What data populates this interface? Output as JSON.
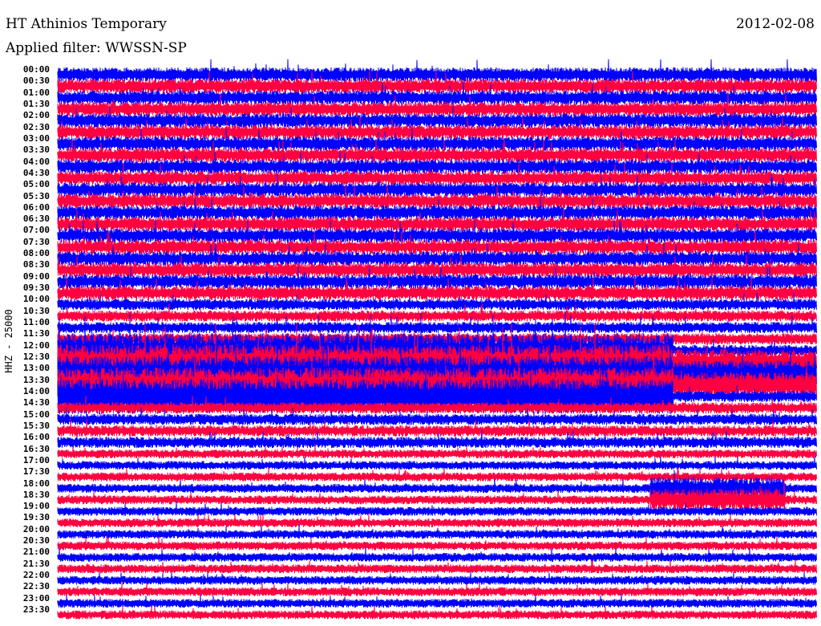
{
  "header": {
    "station": "HT Athinios Temporary",
    "filter": "Applied filter: WWSSN-SP",
    "date": "2012-02-08"
  },
  "chart_data": {
    "type": "line",
    "title": "HT Athinios Temporary",
    "ylabel": "HHZ - 25000",
    "row_labels": [
      "00:00",
      "00:30",
      "01:00",
      "01:30",
      "02:00",
      "02:30",
      "03:00",
      "03:30",
      "04:00",
      "04:30",
      "05:00",
      "05:30",
      "06:00",
      "06:30",
      "07:00",
      "07:30",
      "08:00",
      "08:30",
      "09:00",
      "09:30",
      "10:00",
      "10:30",
      "11:00",
      "11:30",
      "12:00",
      "12:30",
      "13:00",
      "13:30",
      "14:00",
      "14:30",
      "15:00",
      "15:30",
      "16:00",
      "16:30",
      "17:00",
      "17:30",
      "18:00",
      "18:30",
      "19:00",
      "19:30",
      "20:00",
      "20:30",
      "21:00",
      "21:30",
      "22:00",
      "22:30",
      "23:00",
      "23:30"
    ],
    "series_colors": [
      "#0000ff",
      "#ff0040"
    ]
  }
}
